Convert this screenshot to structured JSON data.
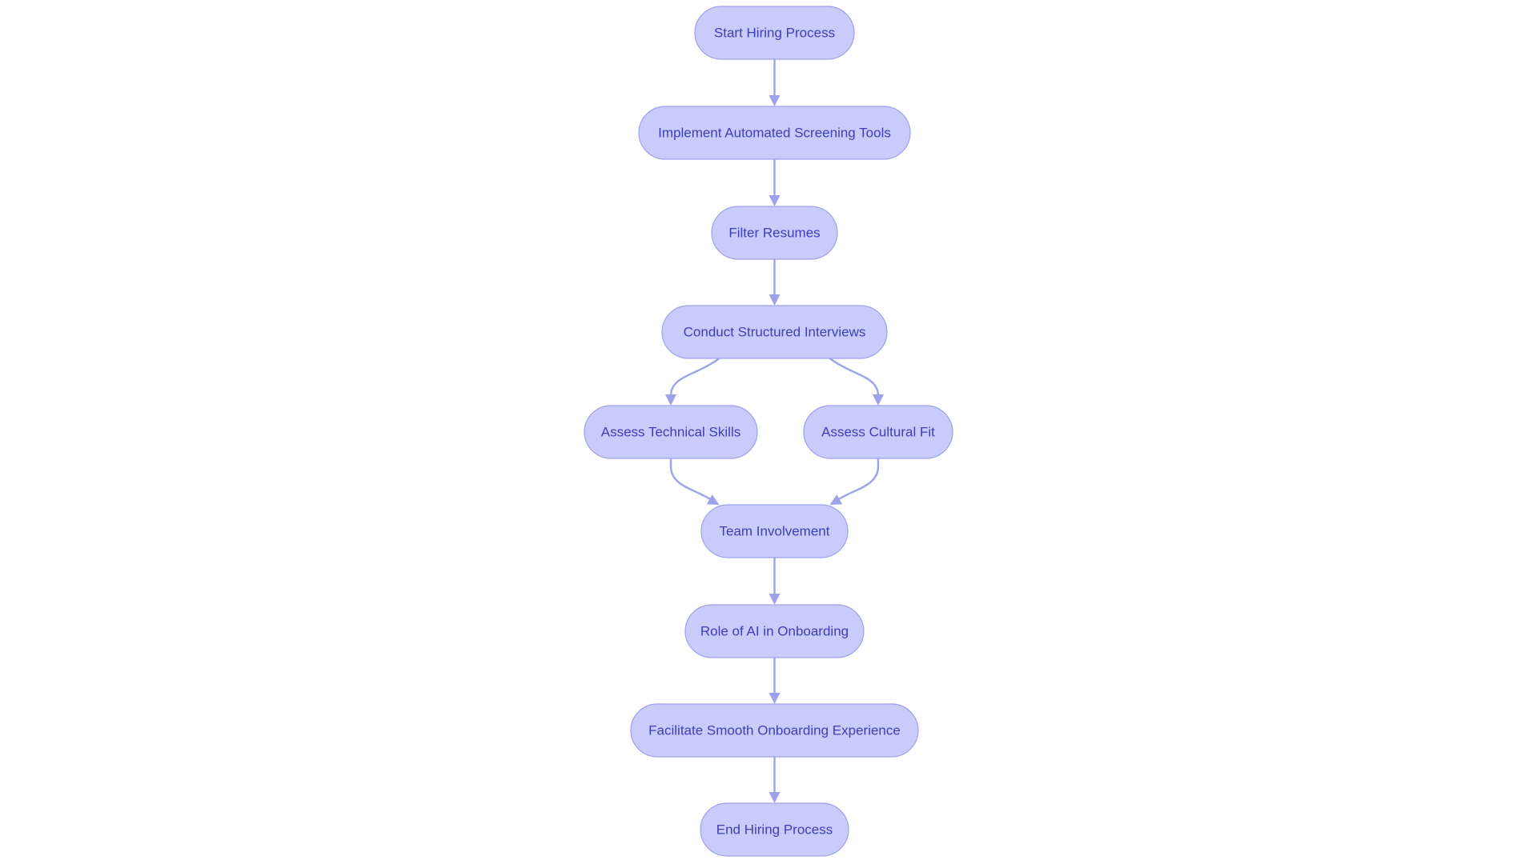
{
  "diagram": {
    "type": "flowchart",
    "direction": "top-to-bottom",
    "colors": {
      "node_fill": "#c9cbfb",
      "node_stroke": "#9ea2ea",
      "text": "#3c3fb5",
      "edge": "#9ea2ea"
    },
    "nodes": [
      {
        "id": "start",
        "label": "Start Hiring Process"
      },
      {
        "id": "screening",
        "label": "Implement Automated Screening Tools"
      },
      {
        "id": "filter",
        "label": "Filter Resumes"
      },
      {
        "id": "interviews",
        "label": "Conduct Structured Interviews"
      },
      {
        "id": "technical",
        "label": "Assess Technical Skills"
      },
      {
        "id": "cultural",
        "label": "Assess Cultural Fit"
      },
      {
        "id": "team",
        "label": "Team Involvement"
      },
      {
        "id": "ai",
        "label": "Role of AI in Onboarding"
      },
      {
        "id": "onboarding",
        "label": "Facilitate Smooth Onboarding Experience"
      },
      {
        "id": "end",
        "label": "End Hiring Process"
      }
    ],
    "edges": [
      {
        "from": "start",
        "to": "screening"
      },
      {
        "from": "screening",
        "to": "filter"
      },
      {
        "from": "filter",
        "to": "interviews"
      },
      {
        "from": "interviews",
        "to": "technical"
      },
      {
        "from": "interviews",
        "to": "cultural"
      },
      {
        "from": "technical",
        "to": "team"
      },
      {
        "from": "cultural",
        "to": "team"
      },
      {
        "from": "team",
        "to": "ai"
      },
      {
        "from": "ai",
        "to": "onboarding"
      },
      {
        "from": "onboarding",
        "to": "end"
      }
    ]
  }
}
